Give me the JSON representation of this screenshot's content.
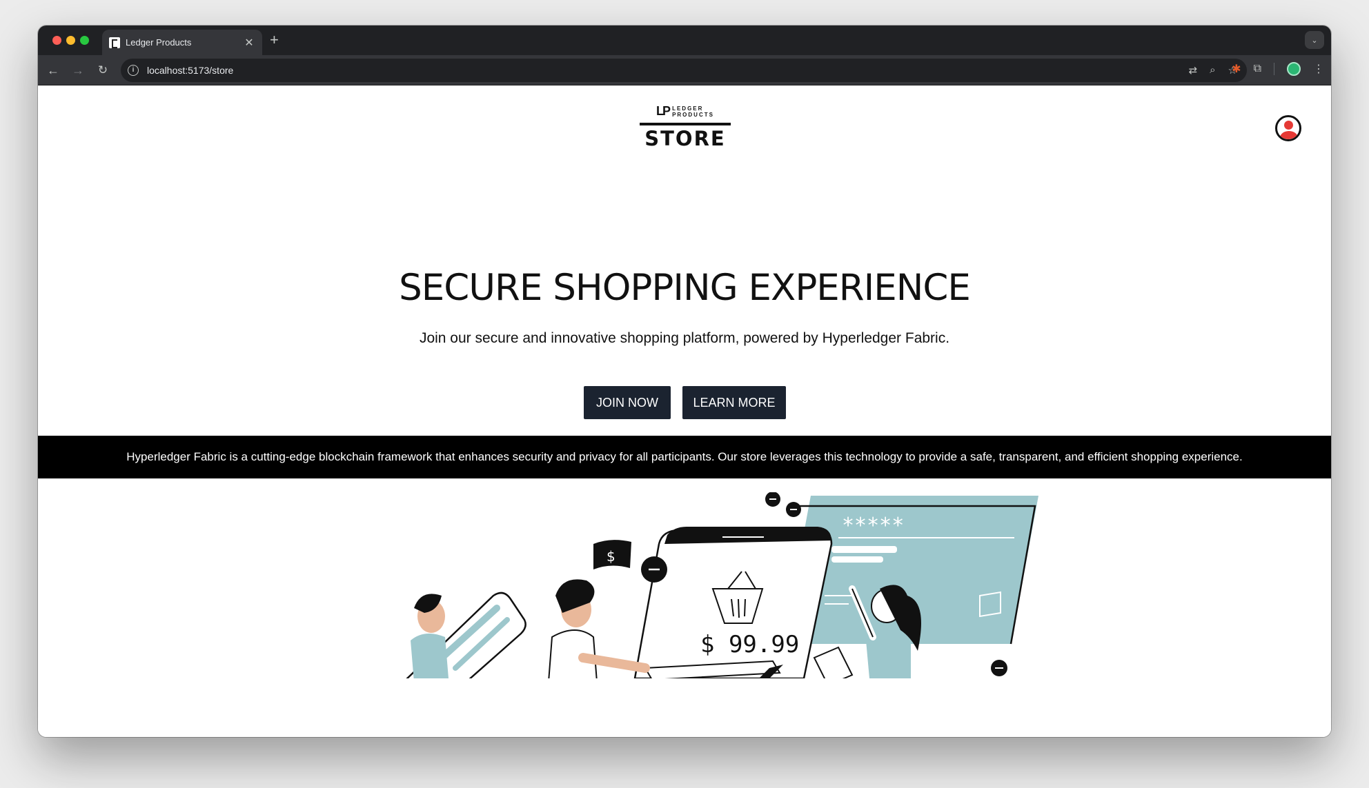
{
  "browser": {
    "tab_title": "Ledger Products",
    "new_tab": "+",
    "url": "localhost:5173/store"
  },
  "header": {
    "logo_mark": "LP",
    "logo_line1": "LEDGER",
    "logo_line2": "PRODUCTS",
    "logo_store": "STORE"
  },
  "hero": {
    "title": "SECURE SHOPPING EXPERIENCE",
    "subtitle": "Join our secure and innovative shopping platform, powered by Hyperledger Fabric.",
    "join_label": "JOIN NOW",
    "learn_label": "LEARN MORE"
  },
  "band": {
    "text": "Hyperledger Fabric is a cutting-edge blockchain framework that enhances security and privacy for all participants. Our store leverages this technology to provide a safe, transparent, and efficient shopping experience."
  },
  "illustration": {
    "price": "$ 99.99",
    "password_mask": "*****",
    "flag_symbol": "$"
  },
  "colors": {
    "button_bg": "#1b2330",
    "accent_teal": "#9dc7cc",
    "band_bg": "#000000"
  }
}
